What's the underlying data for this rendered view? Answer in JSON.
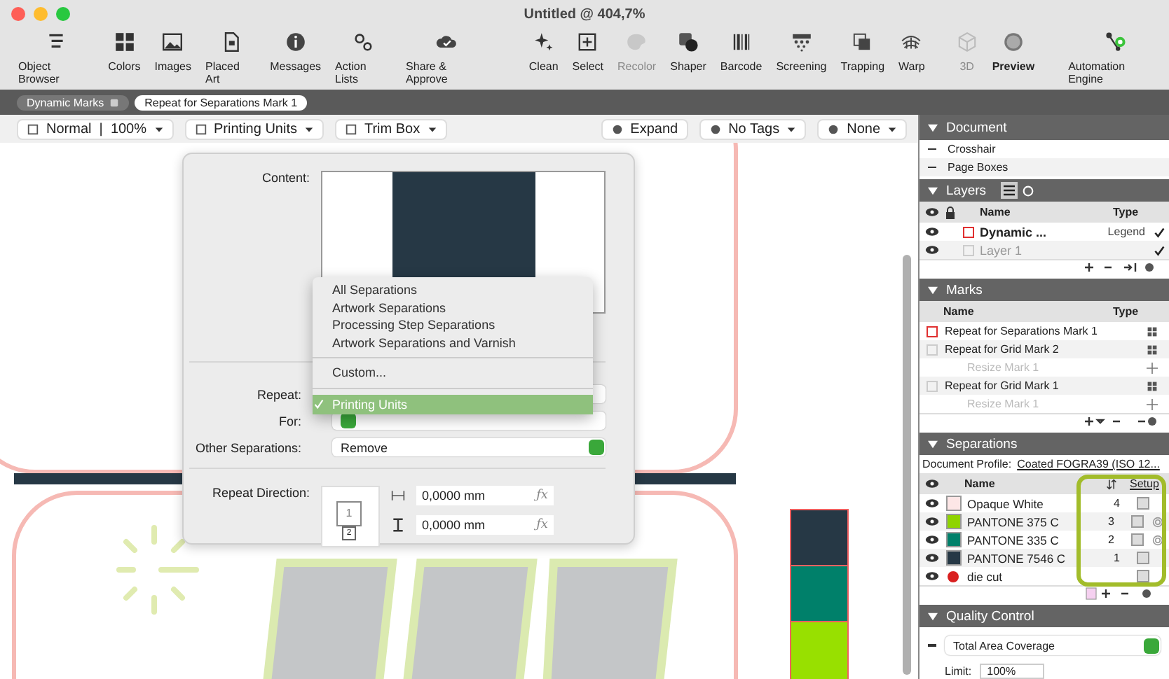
{
  "window": {
    "title": "Untitled @ 404,7%"
  },
  "toolbar": [
    {
      "label": "Object Browser",
      "disabled": false,
      "selected": false
    },
    {
      "label": "Colors",
      "disabled": false,
      "selected": false
    },
    {
      "label": "Images",
      "disabled": false,
      "selected": false
    },
    {
      "label": "Placed Art",
      "disabled": false,
      "selected": false
    },
    {
      "label": "Messages",
      "disabled": false,
      "selected": false
    },
    {
      "label": "Action Lists",
      "disabled": false,
      "selected": false
    },
    {
      "label": "Share & Approve",
      "disabled": false,
      "selected": false
    },
    {
      "label": "Clean",
      "disabled": false,
      "selected": false
    },
    {
      "label": "Select",
      "disabled": false,
      "selected": false
    },
    {
      "label": "Recolor",
      "disabled": true,
      "selected": false
    },
    {
      "label": "Shaper",
      "disabled": false,
      "selected": false
    },
    {
      "label": "Barcode",
      "disabled": false,
      "selected": false
    },
    {
      "label": "Screening",
      "disabled": false,
      "selected": false
    },
    {
      "label": "Trapping",
      "disabled": false,
      "selected": false
    },
    {
      "label": "Warp",
      "disabled": false,
      "selected": false
    },
    {
      "label": "3D",
      "disabled": true,
      "selected": false
    },
    {
      "label": "Preview",
      "disabled": false,
      "selected": true
    },
    {
      "label": "Automation Engine",
      "disabled": false,
      "selected": false
    }
  ],
  "breadcrumbs": [
    {
      "label": "Dynamic Marks",
      "selected": false
    },
    {
      "label": "Repeat for Separations Mark 1",
      "selected": true
    }
  ],
  "view_bar": {
    "left": [
      {
        "label": "Normal  |  100%"
      },
      {
        "label": "Printing Units"
      },
      {
        "label": "Trim Box"
      }
    ],
    "right": [
      {
        "label": "Expand"
      },
      {
        "label": "No Tags"
      },
      {
        "label": "None"
      }
    ]
  },
  "popover": {
    "content_label": "Content:",
    "repeat_label": "Repeat:",
    "for_label": "For:",
    "other_label": "Other Separations:",
    "other_value": "Remove",
    "direction_label": "Repeat Direction:",
    "direction_cells": [
      "1",
      "2"
    ],
    "fields": [
      {
        "value": "0,0000 mm",
        "fx": "ƒx"
      },
      {
        "value": "0,0000 mm",
        "fx": "ƒx"
      }
    ]
  },
  "dropdown": [
    {
      "kind": "item",
      "label": "All Separations",
      "selected": false
    },
    {
      "kind": "item",
      "label": "Artwork Separations",
      "selected": false
    },
    {
      "kind": "item",
      "label": "Processing Step Separations",
      "selected": false
    },
    {
      "kind": "item",
      "label": "Artwork Separations and Varnish",
      "selected": false
    },
    {
      "kind": "separator"
    },
    {
      "kind": "item",
      "label": "Custom...",
      "selected": false
    },
    {
      "kind": "separator"
    },
    {
      "kind": "item",
      "label": "Printing Units",
      "selected": true
    }
  ],
  "document": {
    "title": "Document",
    "expanded": true,
    "items": [
      "Crosshair",
      "Page Boxes"
    ]
  },
  "layers": {
    "title": "Layers",
    "expanded": true,
    "columns": [
      "Name",
      "Type"
    ],
    "rows": [
      {
        "name": "Dynamic ...",
        "type": "Legend",
        "active": true,
        "printable": true
      },
      {
        "name": "Layer 1",
        "type": "",
        "active": false,
        "printable": true
      }
    ]
  },
  "marks": {
    "title": "Marks",
    "expanded": true,
    "columns": [
      "Name",
      "Type"
    ],
    "rows": [
      {
        "name": "Repeat for Separations Mark 1",
        "active": true,
        "children": []
      },
      {
        "name": "Repeat for Grid Mark 2",
        "active": false,
        "children": [
          {
            "name": "Resize Mark 1"
          }
        ]
      },
      {
        "name": "Repeat for Grid Mark 1",
        "active": false,
        "children": [
          {
            "name": "Resize Mark 1"
          }
        ]
      }
    ]
  },
  "separations": {
    "title": "Separations",
    "expanded": true,
    "profile_label": "Document Profile:",
    "profile_value": "Coated FOGRA39 (ISO 12...",
    "columns": [
      "Name",
      "Setup"
    ],
    "rows": [
      {
        "name": "Opaque White",
        "kind": "white",
        "color": "#fde6e6",
        "order": "4",
        "target": false,
        "checked": false
      },
      {
        "name": "PANTONE 375 C",
        "kind": "swatch",
        "color": "#8fd400",
        "order": "3",
        "target": true,
        "checked": false
      },
      {
        "name": "PANTONE 335 C",
        "kind": "swatch",
        "color": "#00806a",
        "order": "2",
        "target": true,
        "checked": false
      },
      {
        "name": "PANTONE 7546 C",
        "kind": "swatch",
        "color": "#263845",
        "order": "1",
        "target": false,
        "checked": false
      },
      {
        "name": "die cut",
        "kind": "dot",
        "color": "#d92020",
        "order": "",
        "target": false,
        "checked": false
      }
    ]
  },
  "quality": {
    "title": "Quality Control",
    "expanded": true,
    "check": "Total Area Coverage",
    "limit_label": "Limit:",
    "limit_value": "100%"
  }
}
